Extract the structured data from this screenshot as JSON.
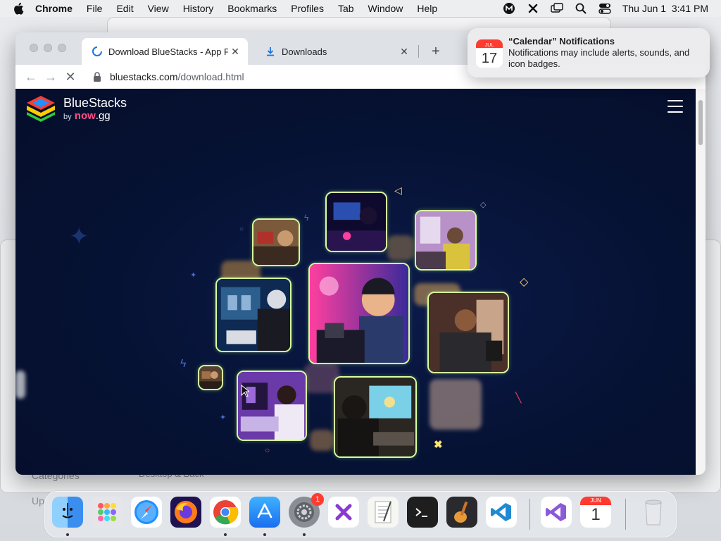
{
  "menubar": {
    "app": "Chrome",
    "items": [
      "File",
      "Edit",
      "View",
      "History",
      "Bookmarks",
      "Profiles",
      "Tab",
      "Window",
      "Help"
    ],
    "clock": "Thu Jun 1  3:41 PM"
  },
  "background_windows": {
    "sidebar_label_1": "Categories",
    "sidebar_label_2": "Up",
    "item_label": "Desktop & Back"
  },
  "browser": {
    "tabs": [
      {
        "title": "Download BlueStacks - App Pl",
        "state": "loading"
      },
      {
        "title": "Downloads",
        "state": "idle"
      }
    ],
    "url_host": "bluestacks.com",
    "url_path": "/download.html"
  },
  "page": {
    "logo_title": "BlueStacks",
    "logo_by": "by",
    "logo_now": "now",
    "logo_gg": ".gg"
  },
  "notification": {
    "title": "“Calendar” Notifications",
    "body": "Notifications may include alerts, sounds, and icon badges.",
    "calendar_month": "JUL",
    "calendar_day": "17"
  },
  "dock": {
    "apps": [
      {
        "name": "Finder",
        "icon": "finder-icon"
      },
      {
        "name": "Launchpad",
        "icon": "launchpad-icon"
      },
      {
        "name": "Safari",
        "icon": "safari-icon"
      },
      {
        "name": "Firefox",
        "icon": "firefox-icon"
      },
      {
        "name": "Chrome",
        "icon": "chrome-icon"
      },
      {
        "name": "App Store",
        "icon": "app-store-icon"
      },
      {
        "name": "System Settings",
        "icon": "settings-icon",
        "badge": "1"
      },
      {
        "name": "Perplexity",
        "icon": "perplexity-icon"
      },
      {
        "name": "TextEdit",
        "icon": "textedit-icon"
      },
      {
        "name": "Terminal",
        "icon": "terminal-icon"
      },
      {
        "name": "GarageBand",
        "icon": "garageband-icon"
      },
      {
        "name": "VS Code",
        "icon": "vscode-icon"
      },
      {
        "name": "Visual Studio",
        "icon": "visual-studio-icon"
      },
      {
        "name": "Calendar",
        "icon": "calendar-icon",
        "month": "JUN",
        "day": "1"
      },
      {
        "name": "Trash",
        "icon": "trash-icon"
      }
    ]
  },
  "colors": {
    "page_bg": "#061233",
    "photo_border": "#d7ff9e",
    "brand_pink": "#ff4f8b",
    "badge_red": "#ff3b30"
  }
}
